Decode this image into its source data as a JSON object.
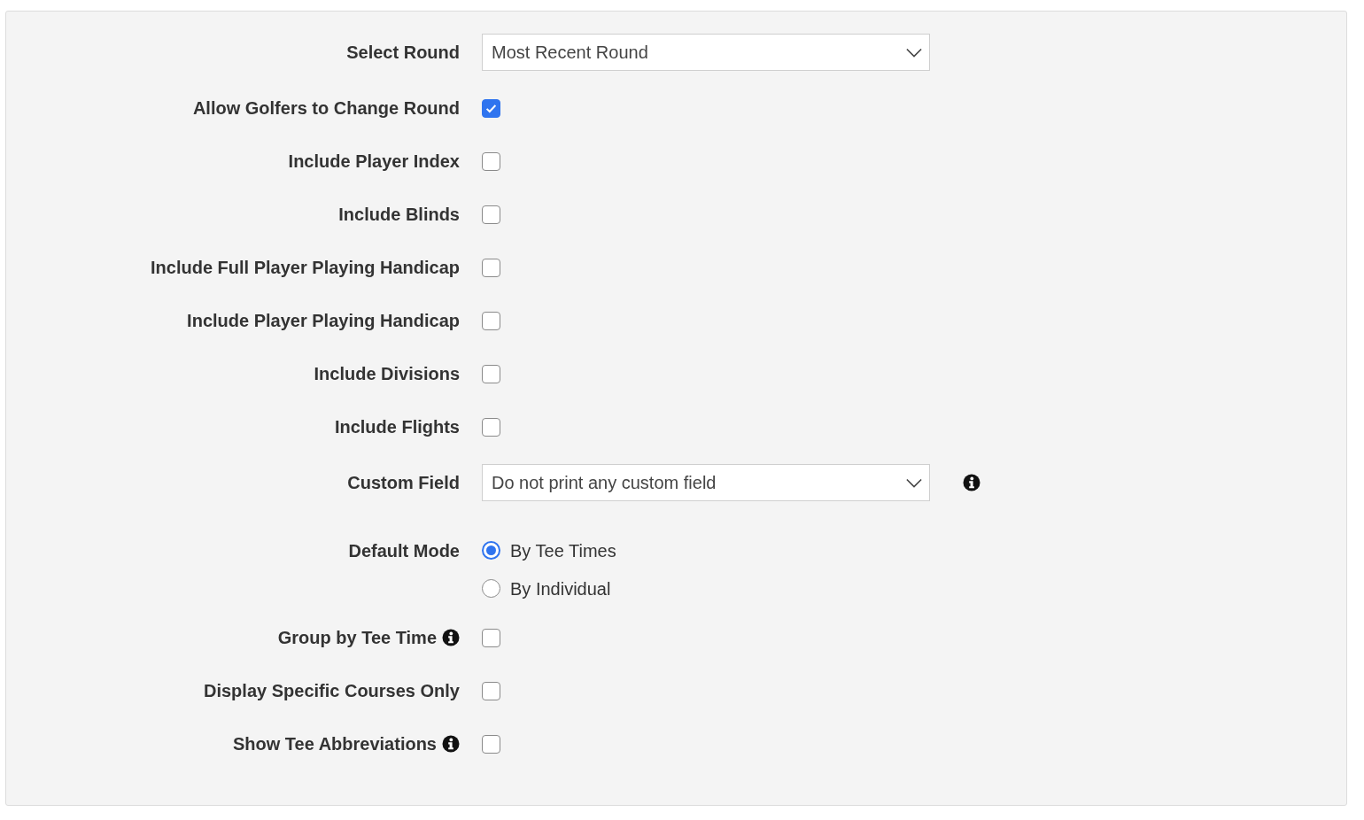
{
  "settings": [
    {
      "kind": "select",
      "label": "Select Round",
      "value": "Most Recent Round"
    },
    {
      "kind": "checkbox",
      "label": "Allow Golfers to Change Round",
      "checked": true
    },
    {
      "kind": "checkbox",
      "label": "Include Player Index",
      "checked": false
    },
    {
      "kind": "checkbox",
      "label": "Include Blinds",
      "checked": false
    },
    {
      "kind": "checkbox",
      "label": "Include Full Player Playing Handicap",
      "checked": false
    },
    {
      "kind": "checkbox",
      "label": "Include Player Playing Handicap",
      "checked": false
    },
    {
      "kind": "checkbox",
      "label": "Include Divisions",
      "checked": false
    },
    {
      "kind": "checkbox",
      "label": "Include Flights",
      "checked": false
    },
    {
      "kind": "select",
      "label": "Custom Field",
      "value": "Do not print any custom field",
      "field_info_icon": true
    },
    {
      "kind": "radio_group",
      "label": "Default Mode",
      "options": [
        {
          "label": "By Tee Times",
          "selected": true
        },
        {
          "label": "By Individual",
          "selected": false
        }
      ]
    },
    {
      "kind": "checkbox",
      "label": "Group by Tee Time",
      "checked": false,
      "label_info_icon": true
    },
    {
      "kind": "checkbox",
      "label": "Display Specific Courses Only",
      "checked": false
    },
    {
      "kind": "checkbox",
      "label": "Show Tee Abbreviations",
      "checked": false,
      "label_info_icon": true
    }
  ]
}
